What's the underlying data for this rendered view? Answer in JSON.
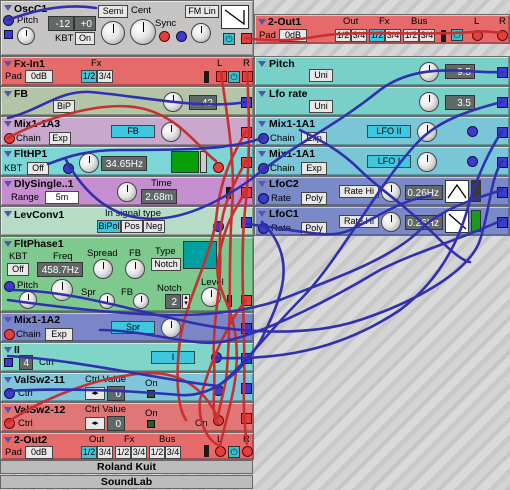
{
  "osc": {
    "title": "OscC1",
    "pitch": "Pitch",
    "semi_val": "-12",
    "cent_val": "+0",
    "semi": "Semi",
    "cent": "Cent",
    "kbt": "KBT",
    "on": "On",
    "sync": "Sync",
    "fmlin": "FM Lin"
  },
  "out1": {
    "title": "2-Out1",
    "out": "Out",
    "fx": "Fx",
    "bus": "Bus",
    "pad": "Pad",
    "db": "0dB",
    "b12": "1/2",
    "b34": "3/4",
    "L": "L",
    "R": "R"
  },
  "fxin": {
    "title": "Fx-In1",
    "fx": "Fx",
    "pad": "Pad",
    "db": "0dB",
    "b12": "1/2",
    "b34": "3/4",
    "L": "L",
    "R": "R"
  },
  "pitch": {
    "title": "Pitch",
    "uni": "Uni",
    "value": "9.5"
  },
  "fb": {
    "title": "FB",
    "bip": "BiP",
    "value": "42"
  },
  "lforate": {
    "title": "Lfo rate",
    "uni": "Uni",
    "value": "3.5"
  },
  "mix1a3": {
    "title": "Mix1-1A3",
    "chain": "Chain",
    "exp": "Exp",
    "fb": "FB"
  },
  "mix1a1a": {
    "title": "Mix1-1A1",
    "chain": "Chain",
    "exp": "Exp",
    "btn": "LFO II"
  },
  "flthp": {
    "title": "FltHP1",
    "kbt": "KBT",
    "off": "Off",
    "freq": "34.65Hz"
  },
  "mix1a1b": {
    "title": "Mix1-1A1",
    "chain": "Chain",
    "exp": "Exp",
    "btn": "LFO I"
  },
  "dly": {
    "title": "DlySingle..1",
    "time": "Time",
    "range": "Range",
    "range_val": "5m",
    "time_val": "2.68m"
  },
  "lfoc2": {
    "title": "LfoC2",
    "rate": "Rate",
    "poly": "Poly",
    "ratehi": "Rate Hi",
    "val": "0.26Hz"
  },
  "levconv": {
    "title": "LevConv1",
    "sigtype": "In signal type",
    "bipol": "BiPol",
    "pos": "Pos",
    "neg": "Neg"
  },
  "lfoc1": {
    "title": "LfoC1",
    "rate": "Rate",
    "poly": "Poly",
    "ratehi": "Rate Hi",
    "val": "0.26Hz"
  },
  "fltphase": {
    "title": "FltPhase1",
    "kbt": "KBT",
    "off": "Off",
    "freq": "Freq",
    "freq_val": "458.7Hz",
    "spread": "Spread",
    "fb": "FB",
    "type": "Type",
    "notch": "Notch",
    "pitch": "Pitch",
    "spr": "Spr",
    "fb2": "FB",
    "notch2": "Notch",
    "notch_val": "2",
    "level": "Level"
  },
  "mix1a2": {
    "title": "Mix1-1A2",
    "chain": "Chain",
    "exp": "Exp",
    "spr": "Spr"
  },
  "ii": {
    "title": "II",
    "ctrl": "Ctrl",
    "val": "4",
    "btn": "I"
  },
  "valsw11": {
    "title": "ValSw2-11",
    "ctrl": "Ctrl",
    "ctrlvalue": "Ctrl Value",
    "on": "On",
    "val": "0"
  },
  "valsw12": {
    "title": "ValSw2-12",
    "ctrl": "Ctrl",
    "ctrlvalue": "Ctrl Value",
    "on": "On",
    "val": "0",
    "on2": "On"
  },
  "out2": {
    "title": "2-Out2",
    "out": "Out",
    "fx": "Fx",
    "bus": "Bus",
    "pad": "Pad",
    "db": "0dB",
    "b12": "1/2",
    "b34": "3/4",
    "L": "L",
    "R": "R"
  },
  "footer": {
    "line1": "Roland Kuit",
    "line2": "SoundLab"
  },
  "colors": {
    "cable_red": "#c83030",
    "cable_blue": "#3030b0"
  }
}
